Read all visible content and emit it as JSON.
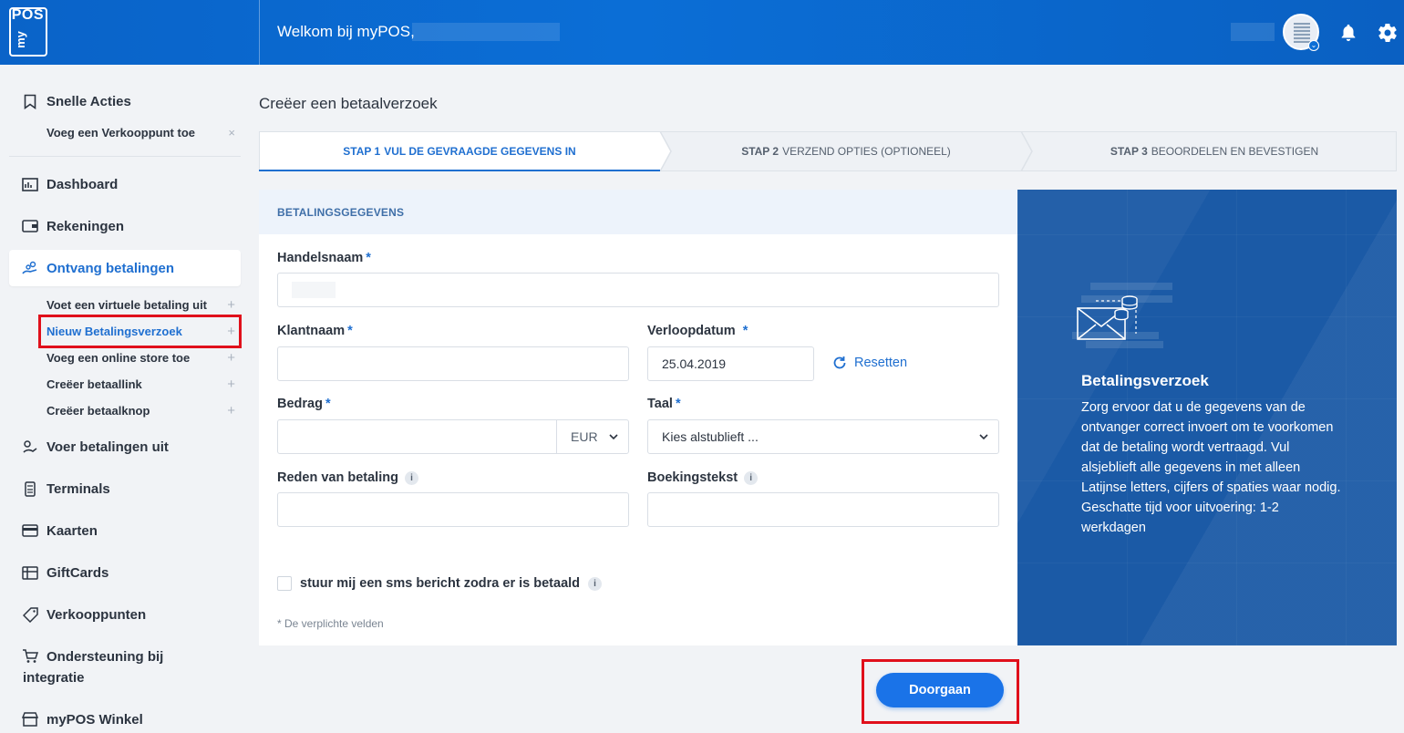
{
  "header": {
    "logo_text_pos": "POS",
    "logo_text_my": "my",
    "welcome": "Welkom bij myPOS,",
    "icons": [
      "company-avatar-icon",
      "bell-icon",
      "gear-icon"
    ]
  },
  "sidebar": {
    "quick_actions": {
      "label": "Snelle Acties",
      "icon": "bookmark-icon"
    },
    "quick_sub": {
      "label": "Voeg een Verkooppunt toe",
      "close": "×"
    },
    "items": [
      {
        "label": "Dashboard",
        "icon": "dashboard-icon"
      },
      {
        "label": "Rekeningen",
        "icon": "wallet-icon"
      },
      {
        "label": "Ontvang betalingen",
        "icon": "receive-payment-icon",
        "active": true
      },
      {
        "label": "Voer betalingen uit",
        "icon": "send-payment-icon"
      },
      {
        "label": "Terminals",
        "icon": "terminal-icon"
      },
      {
        "label": "Kaarten",
        "icon": "card-icon"
      },
      {
        "label": "GiftCards",
        "icon": "giftcard-icon"
      },
      {
        "label": "Verkooppunten",
        "icon": "tag-icon"
      },
      {
        "label": "Ondersteuning bij",
        "icon": "cart-icon"
      },
      {
        "label": "myPOS Winkel",
        "icon": "store-icon"
      }
    ],
    "item_continued": "integratie",
    "subitems": [
      {
        "label": "Voet een virtuele betaling uit"
      },
      {
        "label": "Nieuw Betalingsverzoek",
        "selected": true
      },
      {
        "label": "Voeg een online store toe"
      },
      {
        "label": "Creëer betaallink"
      },
      {
        "label": "Creëer betaalknop"
      }
    ],
    "plus": "+"
  },
  "main": {
    "title": "Creëer een betaalverzoek",
    "steps": [
      {
        "num": "STAP 1",
        "label": "VUL DE GEVRAAGDE GEGEVENS IN",
        "active": true
      },
      {
        "num": "STAP 2",
        "label": "VERZEND OPTIES (OPTIONEEL)"
      },
      {
        "num": "STAP 3",
        "label": "BEOORDELEN EN BEVESTIGEN"
      }
    ],
    "section_title": "BETALINGSGEGEVENS",
    "fields": {
      "handelsnaam": {
        "label": "Handelsnaam",
        "value": ""
      },
      "klantnaam": {
        "label": "Klantnaam",
        "value": ""
      },
      "verloopdatum": {
        "label": "Verloopdatum",
        "value": "25.04.2019"
      },
      "reset": "Resetten",
      "bedrag": {
        "label": "Bedrag",
        "value": "",
        "currency": "EUR"
      },
      "taal": {
        "label": "Taal",
        "placeholder": "Kies alstublieft ..."
      },
      "reden": {
        "label": "Reden van betaling",
        "value": ""
      },
      "boekingstekst": {
        "label": "Boekingstekst",
        "value": ""
      }
    },
    "required_mark": "*",
    "info_mark": "i",
    "sms_checkbox": {
      "label": "stuur mij een sms bericht zodra er is betaald",
      "checked": false
    },
    "required_note": "* De verplichte velden",
    "submit": "Doorgaan"
  },
  "promo": {
    "title": "Betalingsverzoek",
    "text": "Zorg ervoor dat u de gegevens van de ontvanger correct invoert om te voorkomen dat de betaling wordt vertraagd. Vul alsjeblieft alle gegevens in met alleen Latijnse letters, cijfers of spaties waar nodig. Geschatte tijd voor uitvoering: 1-2 werkdagen",
    "icon": "envelope-coins-icon"
  },
  "colors": {
    "brand": "#0b6ed6",
    "accent": "#1a73e8",
    "highlight": "#e0101b",
    "promo_bg": "#1b5aa6"
  }
}
